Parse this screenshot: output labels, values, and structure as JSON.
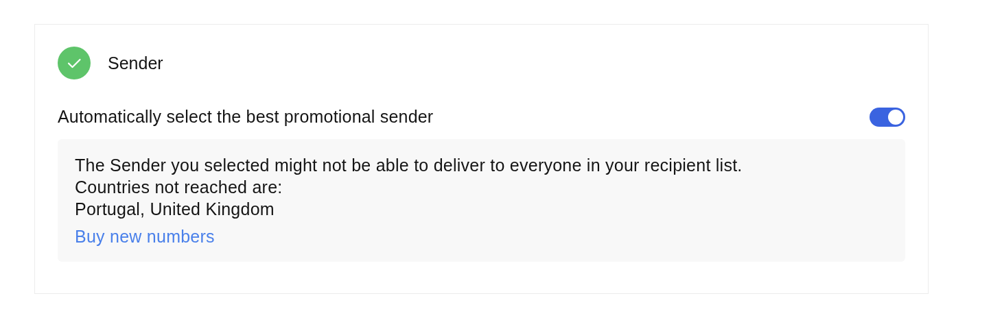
{
  "step": {
    "title": "Sender",
    "completed": true
  },
  "auto_select": {
    "label": "Automatically select the best promotional sender",
    "on": true
  },
  "notice": {
    "lines": [
      "The Sender you selected might not be able to deliver to everyone in your recipient list.",
      "Countries not reached are:",
      "Portugal, United Kingdom"
    ],
    "link": "Buy new numbers"
  }
}
